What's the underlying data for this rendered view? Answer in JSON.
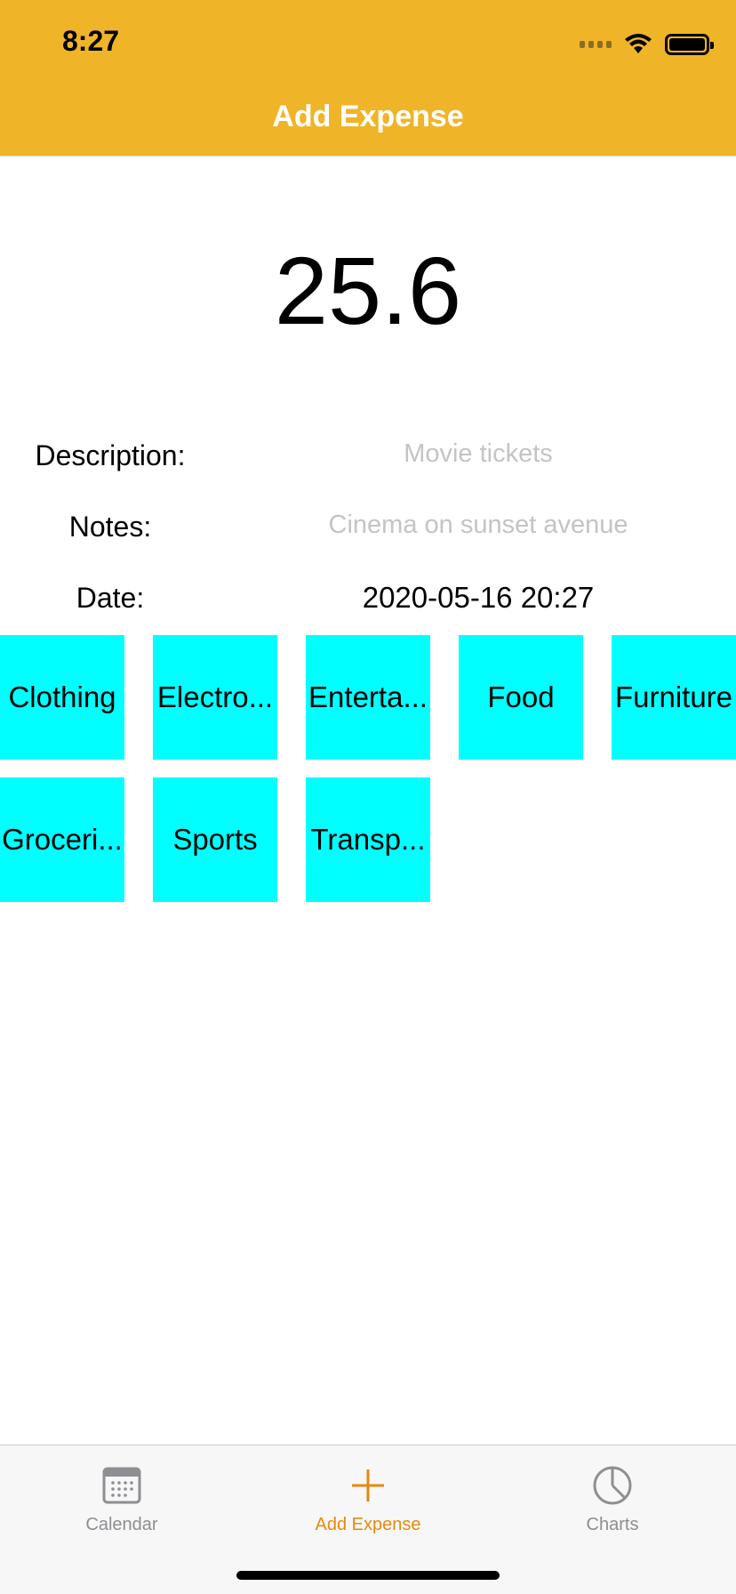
{
  "status": {
    "time": "8:27"
  },
  "nav": {
    "title": "Add Expense"
  },
  "amount": "25.6",
  "form": {
    "description_label": "Description:",
    "description_placeholder": "Movie tickets",
    "notes_label": "Notes:",
    "notes_placeholder": "Cinema on sunset avenue",
    "date_label": "Date:",
    "date_value": "2020-05-16 20:27"
  },
  "categories": [
    "Clothing",
    "Electro...",
    "Enterta...",
    "Food",
    "Furniture",
    "Groceri...",
    "Sports",
    "Transp..."
  ],
  "tabbar": {
    "calendar": "Calendar",
    "add_expense": "Add Expense",
    "charts": "Charts"
  },
  "colors": {
    "header": "#f0b429",
    "category_tile": "#00ffff",
    "active_tab": "#e8890c",
    "inactive_tab": "#8e8e93"
  },
  "icons": {
    "calendar": "calendar-icon",
    "add_expense": "plus-icon",
    "charts": "pie-chart-icon"
  }
}
